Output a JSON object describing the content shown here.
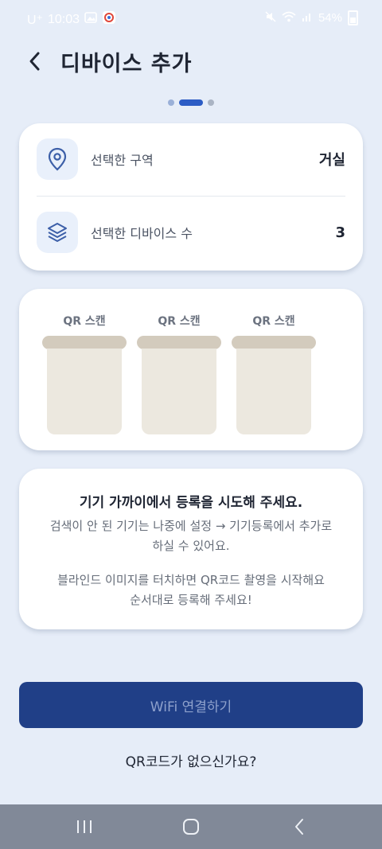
{
  "status_bar": {
    "carrier": "U⁺",
    "time": "10:03",
    "battery": "54%"
  },
  "header": {
    "title": "디바이스 추가"
  },
  "pager": {
    "count": 3,
    "active_index": 1
  },
  "summary": {
    "zone_label": "선택한 구역",
    "zone_value": "거실",
    "device_count_label": "선택한 디바이스 수",
    "device_count_value": "3"
  },
  "qr_slots": [
    {
      "label": "QR 스캔"
    },
    {
      "label": "QR 스캔"
    },
    {
      "label": "QR 스캔"
    }
  ],
  "info": {
    "title": "기기 가까이에서 등록을 시도해 주세요.",
    "line1": "검색이 안 된 기기는 나중에 설정 → 기기등록에서 추가로",
    "line2": "하실 수 있어요.",
    "line3": "블라인드 이미지를 터치하면 QR코드 촬영을 시작해요",
    "line4": "순서대로 등록해 주세요!"
  },
  "buttons": {
    "wifi_connect": "WiFi 연결하기",
    "no_qr_link": "QR코드가 없으신가요?"
  },
  "colors": {
    "background": "#e6edf8",
    "primary": "#203f87",
    "accent": "#2c5cc5",
    "blind_bar": "#d3cbbd",
    "blind_panel": "#ece8df"
  }
}
